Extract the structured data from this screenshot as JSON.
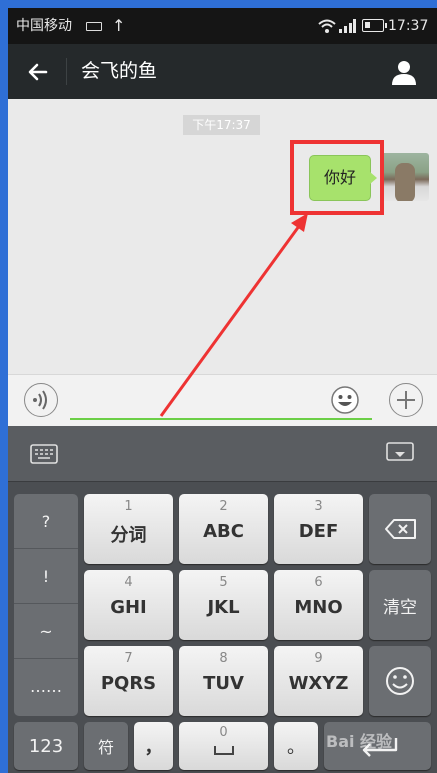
{
  "status_bar": {
    "carrier": "中国移动",
    "time": "17:37"
  },
  "header": {
    "title": "会飞的鱼"
  },
  "chat": {
    "timestamp": "下午17:37",
    "messages": [
      {
        "text": "你好",
        "sender": "self"
      }
    ]
  },
  "keyboard": {
    "symbols": [
      "?",
      "!",
      "~",
      "……"
    ],
    "keys": [
      {
        "num": "1",
        "label": "分词"
      },
      {
        "num": "2",
        "label": "ABC"
      },
      {
        "num": "3",
        "label": "DEF"
      },
      {
        "num": "4",
        "label": "GHI"
      },
      {
        "num": "5",
        "label": "JKL"
      },
      {
        "num": "6",
        "label": "MNO"
      },
      {
        "num": "7",
        "label": "PQRS"
      },
      {
        "num": "8",
        "label": "TUV"
      },
      {
        "num": "9",
        "label": "WXYZ"
      }
    ],
    "clear_label": "清空",
    "mode_label": "123",
    "symbol_label": "符",
    "comma_label": "，",
    "zero_num": "0",
    "period_label": "。"
  },
  "watermark": "Bai 经验",
  "colors": {
    "header_bg": "#25292b",
    "bubble": "#a7e26c",
    "highlight": "#ee3333",
    "input_underline": "#6ccf47"
  }
}
